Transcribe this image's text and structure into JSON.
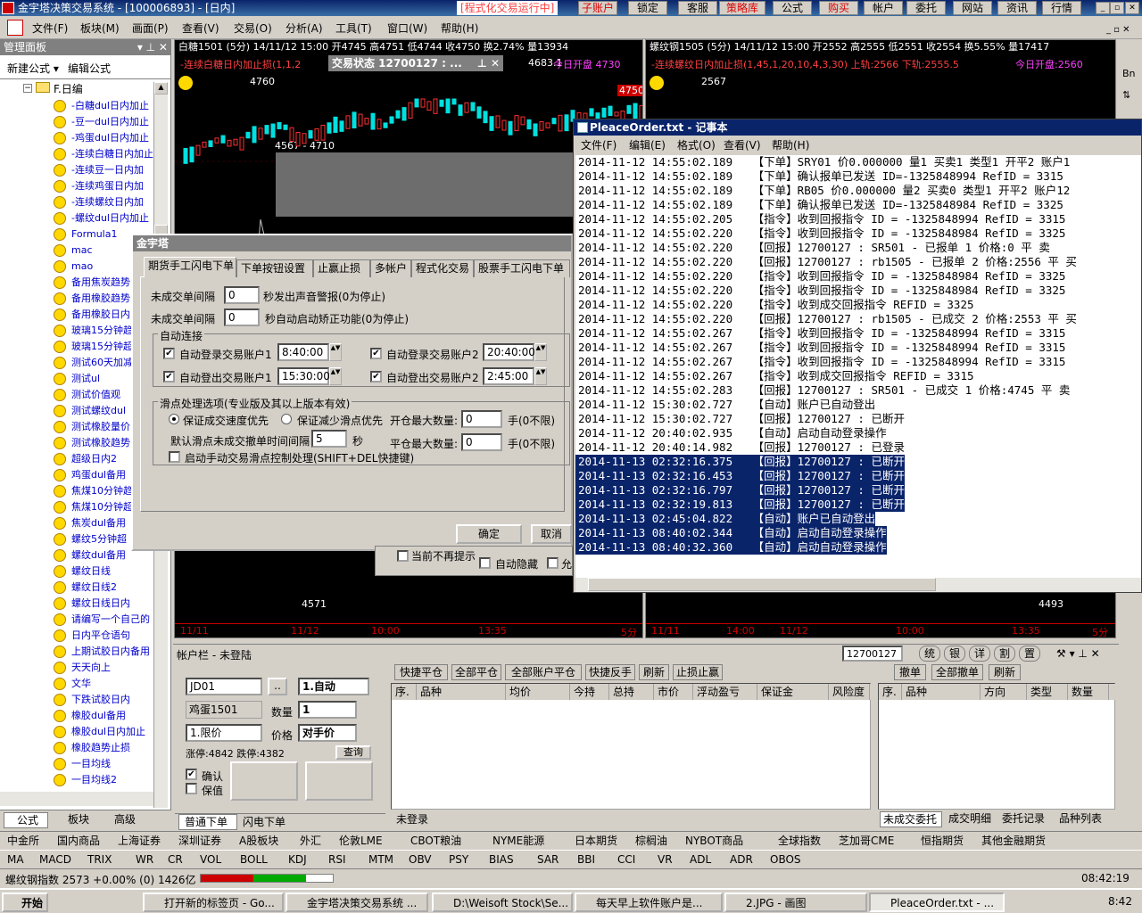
{
  "title": "金宇塔决策交易系统 - [100006893] - [日内]",
  "title_warning": "[程式化交易运行中]",
  "top_buttons": [
    "子账户",
    "锁定",
    "客服",
    "策略库",
    "公式",
    "购买",
    "帐户",
    "委托",
    "网站",
    "资讯",
    "行情"
  ],
  "menu": [
    "文件(F)",
    "板块(M)",
    "画面(P)",
    "查看(V)",
    "交易(O)",
    "分析(A)",
    "工具(T)",
    "窗口(W)",
    "帮助(H)"
  ],
  "left_panel": {
    "title": "管理面板",
    "actions": [
      "新建公式",
      "编辑公式"
    ],
    "folder": "F.日编",
    "items": [
      "-白糖dul日内加止",
      "-豆一dul日内加止",
      "-鸡蛋dul日内加止",
      "-连续白糖日内加止",
      "-连续豆一日内加",
      "-连续鸡蛋日内加",
      "-连续螺纹日内加",
      "-螺纹dul日内加止",
      "Formula1",
      "mac",
      "mao",
      "备用焦炭趋势",
      "备用橡胶趋势",
      "备用橡胶日内",
      "玻璃15分钟趋",
      "玻璃15分钟超",
      "测试60天加减",
      "测试ul",
      "测试价值观",
      "测试螺纹dul",
      "测试橡胶量价",
      "测试橡胶趋势",
      "超级日内2",
      "鸡蛋dul备用",
      "焦煤10分钟趋",
      "焦煤10分钟超",
      "焦炭dul备用",
      "螺纹5分钟超",
      "螺纹dul备用",
      "螺纹日线",
      "螺纹日线2",
      "螺纹日线日内",
      "请编写一个自己的",
      "日内平仓语句",
      "上期试胶日内备用",
      "天天向上",
      "文华",
      "下跌试胶日内",
      "橡胶dul备用",
      "橡胶dul日内加止",
      "橡胶趋势止损",
      "一目均线",
      "一目均线2"
    ],
    "tabs": [
      "公式",
      "板块",
      "高级"
    ]
  },
  "chart1": {
    "header": "白糖1501 (5分) 14/11/12 15:00 开4745 高4751 低4744 收4750 换2.74% 量13934",
    "formula": "-连续白糖日内加止损(1,1,2",
    "price_right": "4683.1",
    "today_open": "今日开盘 4730",
    "price_4760": "4760",
    "price_4750": "4750",
    "price_4567": "4567 - 4710",
    "price_4571": "4571",
    "x_labels": [
      "11/11",
      "11/12",
      "10:00",
      "13:35",
      "5分"
    ]
  },
  "chart2": {
    "header": "螺纹钢1505 (5分) 14/11/12 15:00 开2552 高2555 低2551 收2554 换5.55% 量17417",
    "formula": "-连续螺纹日内加止损(1,45,1,20,10,4,3,30) 上轨:2566 下轨:2555.5",
    "today_open": "今日开盘:2560",
    "price_2567": "2567",
    "price_4493": "4493",
    "x_labels": [
      "11/11",
      "14:00",
      "11/12",
      "10:00",
      "13:35",
      "5分"
    ]
  },
  "trade_status_popup": "交易状态 12700127 : ...",
  "notepad": {
    "title": "PleaceOrder.txt - 记事本",
    "menu": [
      "文件(F)",
      "编辑(E)",
      "格式(O)",
      "查看(V)",
      "帮助(H)"
    ],
    "lines": [
      "2014-11-12 14:55:02.189   【下单】SRY01 价0.000000 量1 买卖1 类型1 开平2 账户1",
      "2014-11-12 14:55:02.189   【下单】确认报单已发送 ID=-1325848994 RefID = 3315",
      "2014-11-12 14:55:02.189   【下单】RB05 价0.000000 量2 买卖0 类型1 开平2 账户12",
      "2014-11-12 14:55:02.189   【下单】确认报单已发送 ID=-1325848984 RefID = 3325",
      "2014-11-12 14:55:02.205   【指令】收到回报指令 ID = -1325848994 RefID = 3315",
      "2014-11-12 14:55:02.220   【指令】收到回报指令 ID = -1325848984 RefID = 3325",
      "2014-11-12 14:55:02.220   【回报】12700127 : SR501 - 已报单 1 价格:0 平 卖",
      "2014-11-12 14:55:02.220   【回报】12700127 : rb1505 - 已报单 2 价格:2556 平 买",
      "2014-11-12 14:55:02.220   【指令】收到回报指令 ID = -1325848984 RefID = 3325",
      "2014-11-12 14:55:02.220   【指令】收到回报指令 ID = -1325848984 RefID = 3325",
      "2014-11-12 14:55:02.220   【指令】收到成交回报指令 REFID = 3325",
      "2014-11-12 14:55:02.220   【回报】12700127 : rb1505 - 已成交 2 价格:2553 平 买",
      "2014-11-12 14:55:02.267   【指令】收到回报指令 ID = -1325848994 RefID = 3315",
      "2014-11-12 14:55:02.267   【指令】收到回报指令 ID = -1325848994 RefID = 3315",
      "2014-11-12 14:55:02.267   【指令】收到回报指令 ID = -1325848994 RefID = 3315",
      "2014-11-12 14:55:02.267   【指令】收到成交回报指令 REFID = 3315",
      "2014-11-12 14:55:02.283   【回报】12700127 : SR501 - 已成交 1 价格:4745 平 卖",
      "2014-11-12 15:30:02.727   【自动】账户已自动登出",
      "2014-11-12 15:30:02.727   【回报】12700127 : 已断开",
      "2014-11-12 20:40:02.935   【自动】启动自动登录操作",
      "2014-11-12 20:40:14.982   【回报】12700127 : 已登录",
      "2014-11-13 02:32:16.375   【回报】12700127 : 已断开",
      "2014-11-13 02:32:16.453   【回报】12700127 : 已断开",
      "2014-11-13 02:32:16.797   【回报】12700127 : 已断开",
      "2014-11-13 02:32:19.813   【回报】12700127 : 已断开",
      "2014-11-13 02:45:04.822   【自动】账户已自动登出",
      "2014-11-13 08:40:02.344   【自动】启动自动登录操作",
      "2014-11-13 08:40:32.360   【自动】启动自动登录操作"
    ],
    "selected_from": 21
  },
  "dialog": {
    "title": "金宇塔",
    "tabs": [
      "期货手工闪电下单",
      "下单按钮设置",
      "止赢止损",
      "多帐户",
      "程式化交易",
      "股票手工闪电下单"
    ],
    "unfilled_label1": "未成交单间隔",
    "unfilled_value1": "0",
    "unfilled_suffix1": "秒发出声音警报(0为停止)",
    "unfilled_label2": "未成交单间隔",
    "unfilled_value2": "0",
    "unfilled_suffix2": "秒自动启动矫正功能(0为停止)",
    "auto_group": "自动连接",
    "auto_login1": "自动登录交易账户1",
    "auto_login1_time": "8:40:00",
    "auto_login2": "自动登录交易账户2",
    "auto_login2_time": "20:40:00",
    "auto_logout1": "自动登出交易账户1",
    "auto_logout1_time": "15:30:00",
    "auto_logout2": "自动登出交易账户2",
    "auto_logout2_time": "2:45:00",
    "slip_group": "滑点处理选项(专业版及其以上版本有效)",
    "radio1": "保证成交速度优先",
    "radio2": "保证减少滑点优先",
    "max_open": "开仓最大数量:",
    "max_open_value": "0",
    "max_open_suffix": "手(0不限)",
    "default_slip": "默认滑点未成交撤单时间间隔",
    "default_slip_value": "5",
    "default_slip_unit": "秒",
    "max_close": "平仓最大数量:",
    "max_close_value": "0",
    "max_close_suffix": "手(0不限)",
    "manual_slip": "启动手动交易滑点控制处理(SHIFT+DEL快捷键)",
    "ok": "确定",
    "cancel": "取消"
  },
  "hidden_dialog": {
    "not_remind": "当前不再提示",
    "auto_hide": "自动隐藏",
    "allow": "允"
  },
  "account_bar": {
    "title": "帐户栏 - 未登陆",
    "account_select": "12700127",
    "toolbar": [
      "统",
      "银",
      "详",
      "割",
      "置"
    ],
    "contract_code": "JD01",
    "contract_name": "鸡蛋1501",
    "mode": "1.自动",
    "qty_label": "数量",
    "qty": "1",
    "price_type": "1.限价",
    "price_label": "价格",
    "price": "对手价",
    "limit_up": "涨停:4842 跌停:4382",
    "query": "查询",
    "confirm": "确认",
    "keep": "保值",
    "bottom_tabs": [
      "普通下单",
      "闪电下单"
    ],
    "position_buttons": [
      "快捷平仓",
      "全部平仓",
      "全部账户平仓",
      "快捷反手",
      "刷新",
      "止损止赢"
    ],
    "position_cols": [
      "序.",
      "品种",
      "均价",
      "今持",
      "总持",
      "市价",
      "浮动盈亏",
      "保证金",
      "风险度"
    ],
    "status": "未登录",
    "order_buttons": [
      "撤单",
      "全部撤单",
      "刷新"
    ],
    "order_cols": [
      "序.",
      "品种",
      "方向",
      "类型",
      "数量"
    ],
    "order_tabs": [
      "未成交委托",
      "成交明细",
      "委托记录",
      "品种列表"
    ]
  },
  "market_tabs": [
    "中金所",
    "国内商品",
    "上海证券",
    "深圳证券",
    "A股板块",
    "外汇",
    "伦敦LME",
    "CBOT粮油",
    "NYME能源",
    "日本期货",
    "棕榈油",
    "NYBOT商品",
    "全球指数",
    "芝加哥CME",
    "恒指期货",
    "其他金融期货"
  ],
  "indicator_tabs": [
    "MA",
    "MACD",
    "TRIX",
    "WR",
    "CR",
    "VOL",
    "BOLL",
    "KDJ",
    "RSI",
    "MTM",
    "OBV",
    "PSY",
    "BIAS",
    "SAR",
    "BBI",
    "CCI",
    "VR",
    "ADL",
    "ADR",
    "OBOS"
  ],
  "status_bar": {
    "ticker": "螺纹钢指数 2573 +0.00% (0) 1426亿",
    "time": "08:42:19"
  },
  "taskbar": {
    "start": "开始",
    "tasks": [
      "打开新的标签页 - Go...",
      "金宇塔决策交易系统 ...",
      "D:\\Weisoft Stock\\Se...",
      "每天早上软件账户是...",
      "2.JPG - 画图",
      "PleaceOrder.txt - ..."
    ],
    "clock": "8:42"
  },
  "colors": {
    "title_blue": "#0a246a",
    "chart_bg": "#000000",
    "up_red": "#ff3030",
    "down_cyan": "#00e0e0",
    "selection": "#0a246a"
  }
}
